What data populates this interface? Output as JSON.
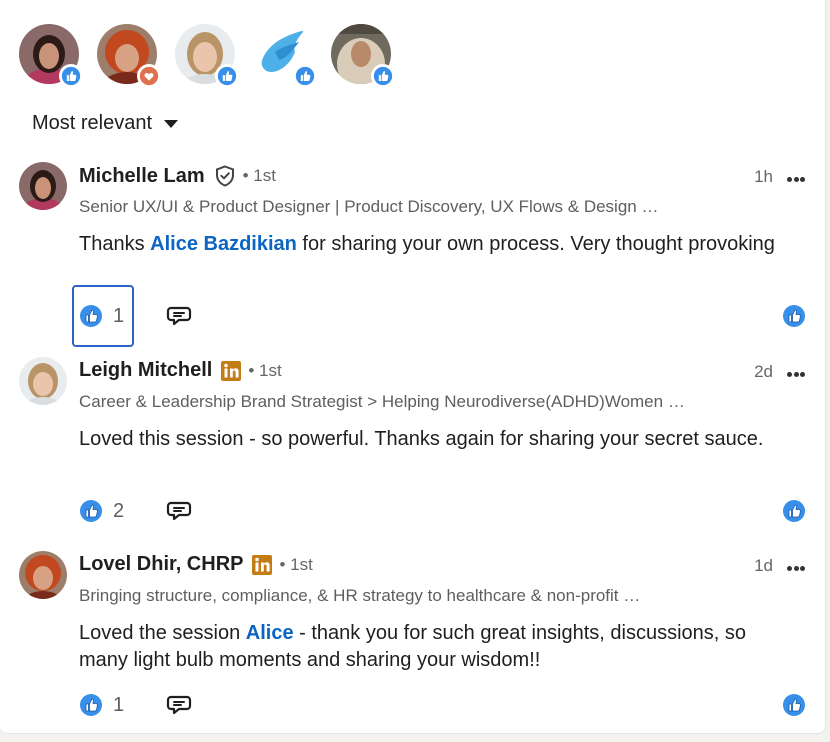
{
  "reactors": [
    {
      "name": "reactor-1",
      "reaction": "like-icon"
    },
    {
      "name": "reactor-2",
      "reaction": "love-icon"
    },
    {
      "name": "reactor-3",
      "reaction": "like-icon"
    },
    {
      "name": "reactor-4",
      "reaction": "like-icon"
    },
    {
      "name": "reactor-5",
      "reaction": "like-icon"
    }
  ],
  "sort": {
    "label": "Most relevant",
    "icon": "caret-down-icon"
  },
  "comments": [
    {
      "name": "Michelle Lam",
      "badge": "verified-shield-icon",
      "degree": "• 1st",
      "time": "1h",
      "headline": "Senior UX/UI & Product Designer | Product Discovery, UX Flows & Design …",
      "text_before": "Thanks ",
      "mention": "Alice Bazdikian",
      "text_after": " for sharing your own process. Very thought provoking",
      "likes": "1"
    },
    {
      "name": "Leigh Mitchell",
      "badge": "linkedin-icon",
      "degree": "• 1st",
      "time": "2d",
      "headline": "Career & Leadership Brand Strategist > Helping Neurodiverse(ADHD)Women …",
      "text": "Loved this session - so powerful. Thanks again for sharing your secret sauce.",
      "likes": "2"
    },
    {
      "name": "Lovel Dhir, CHRP",
      "badge": "linkedin-icon",
      "degree": "• 1st",
      "time": "1d",
      "headline": "Bringing structure, compliance, & HR strategy to healthcare & non-profit …",
      "text_before": "Loved the session ",
      "mention": "Alice",
      "text_after": " - thank you for such great insights, discussions, so many light bulb moments and sharing your wisdom!!",
      "likes": "1"
    }
  ],
  "colors": {
    "accent": "#0a66c2",
    "like_blue": "#378fe9",
    "love_orange": "#df704d",
    "linkedin_badge": "#c37d16",
    "focus_outline": "#2d62c8"
  }
}
